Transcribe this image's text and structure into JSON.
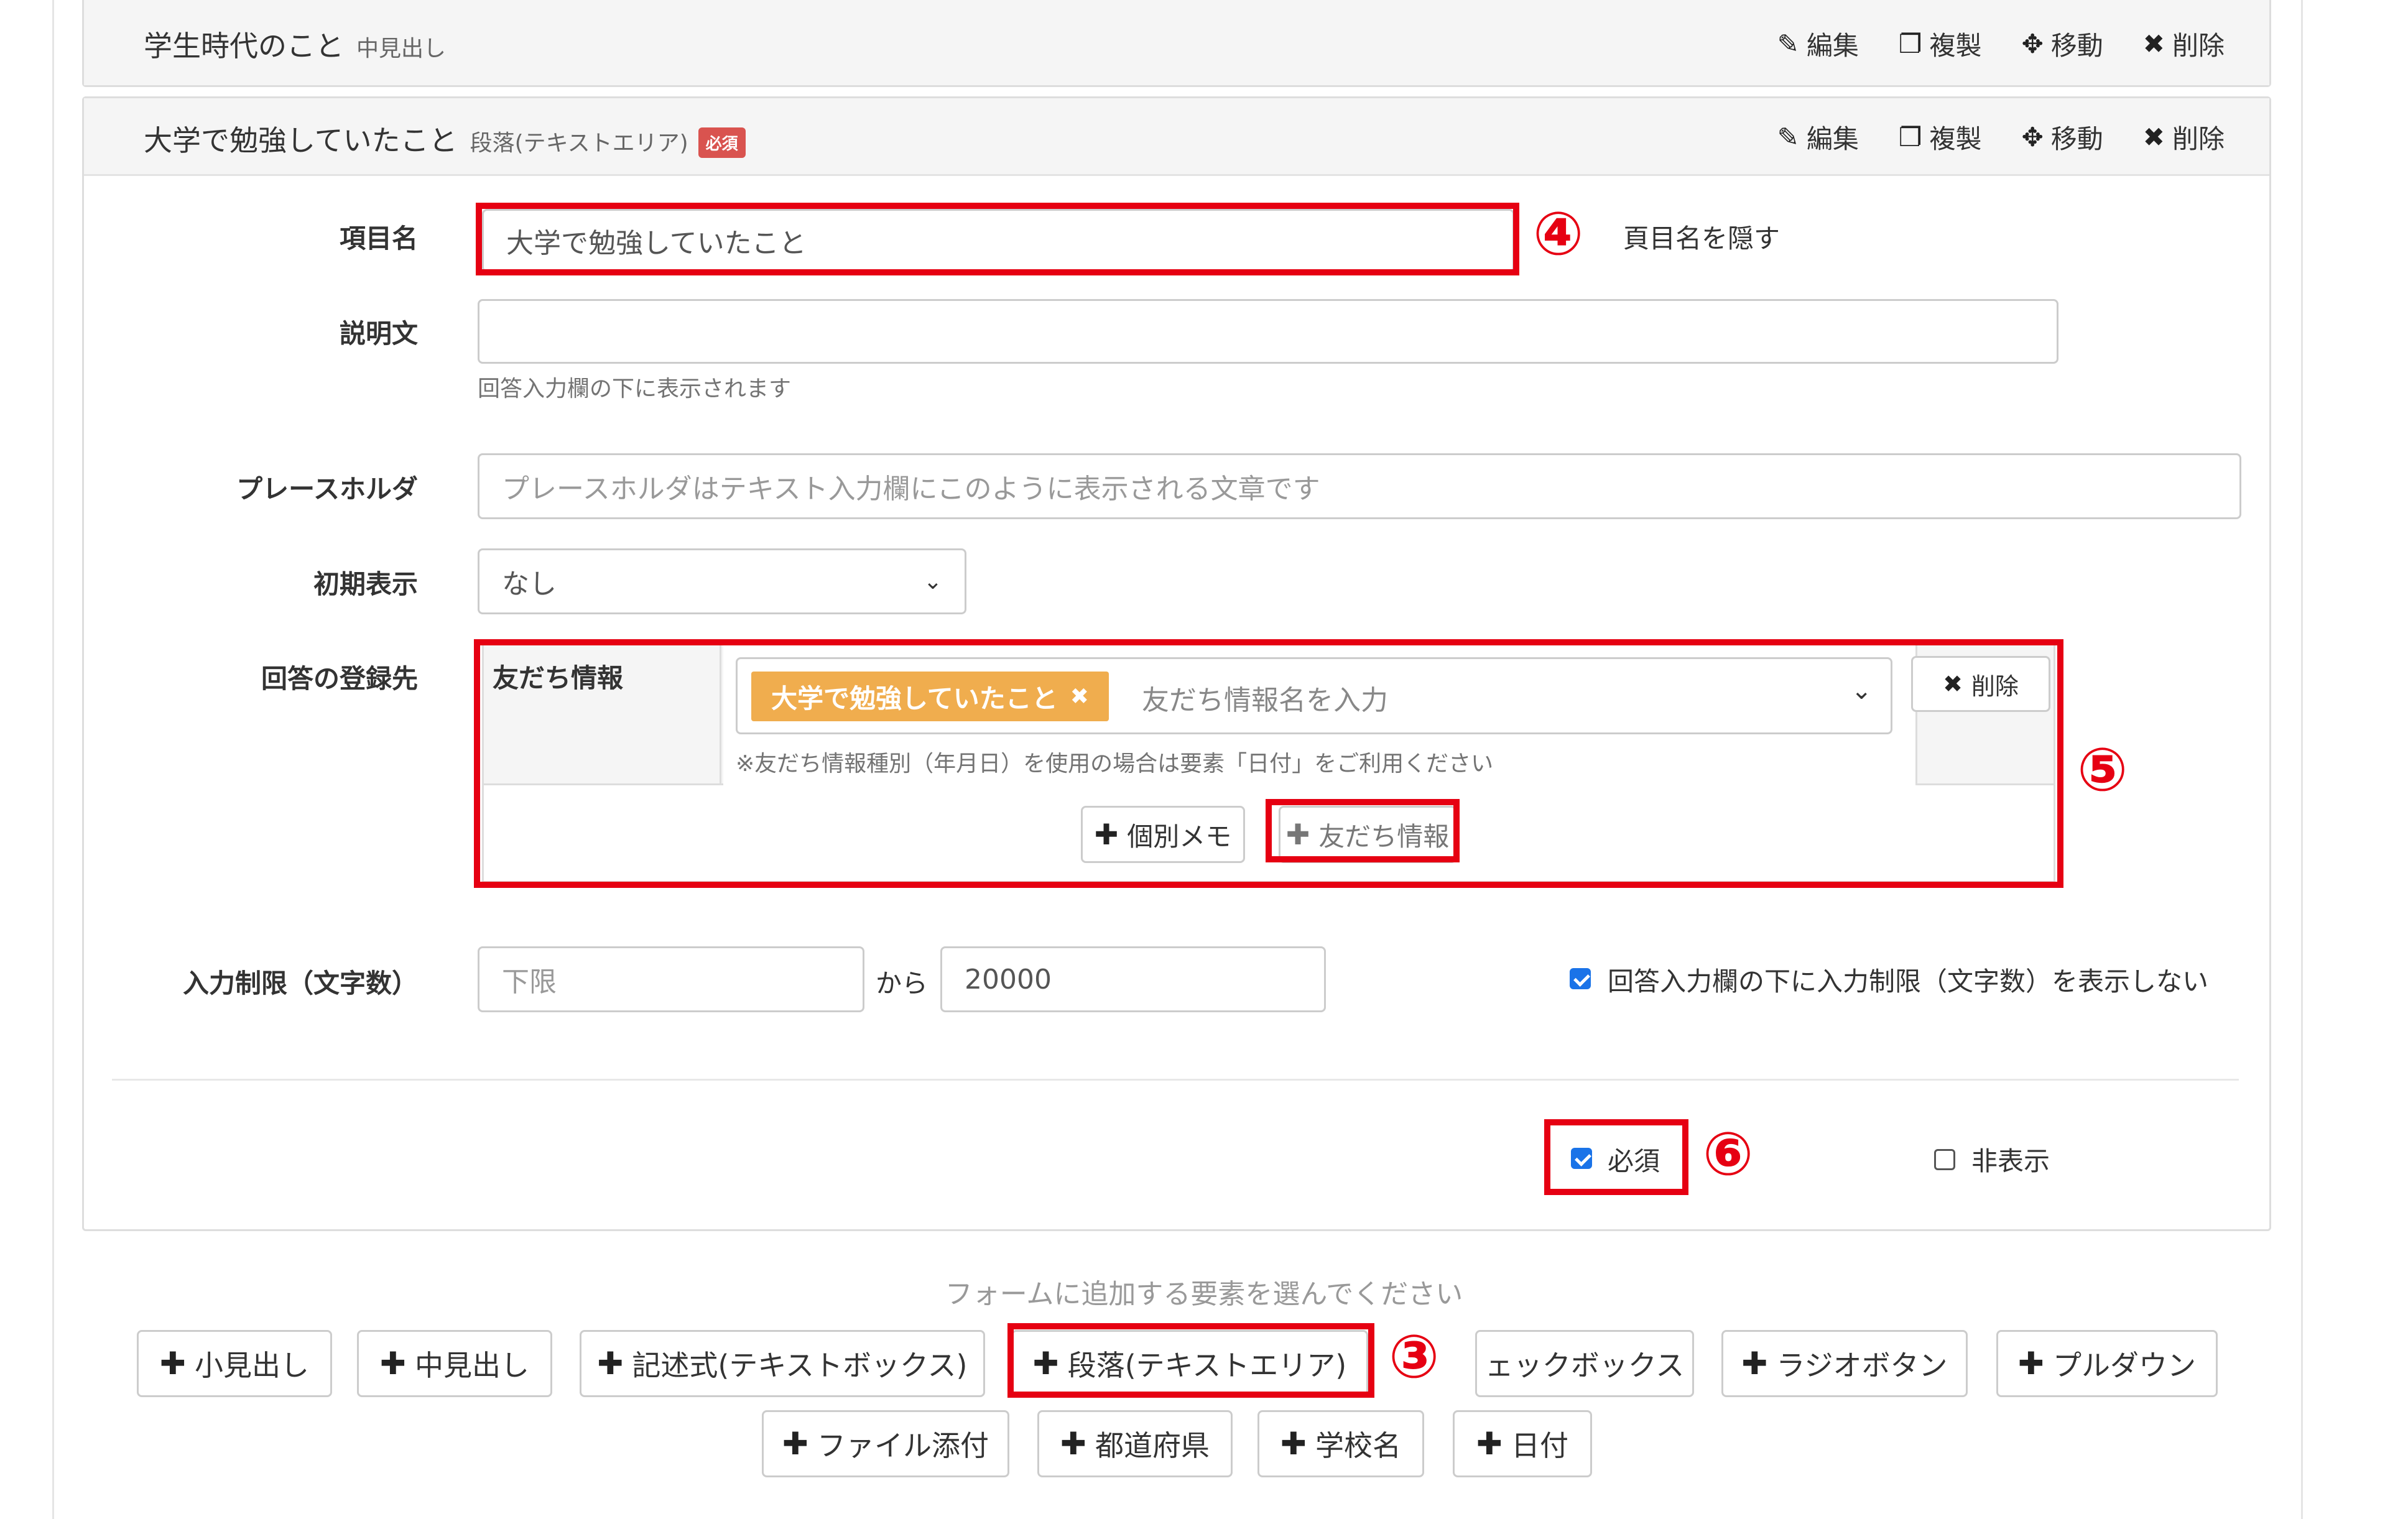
{
  "panel1": {
    "title": "学生時代のこと",
    "type": "中見出し",
    "actions": {
      "edit": "編集",
      "copy": "複製",
      "move": "移動",
      "delete": "削除"
    }
  },
  "panel2": {
    "title": "大学で勉強していたこと",
    "type": "段落(テキストエリア)",
    "required_badge": "必須",
    "actions": {
      "edit": "編集",
      "copy": "複製",
      "move": "移動",
      "delete": "削除"
    }
  },
  "form": {
    "item_name_label": "項目名",
    "item_name_value": "大学で勉強していたこと",
    "hide_name_label": "頁目名を隠す",
    "description_label": "説明文",
    "description_value": "",
    "description_help": "回答入力欄の下に表示されます",
    "placeholder_label": "プレースホルダ",
    "placeholder_placeholder": "プレースホルダはテキスト入力欄にこのように表示される文章です",
    "initial_label": "初期表示",
    "initial_value": "なし",
    "register_label": "回答の登録先",
    "friend_info_label": "友だち情報",
    "friend_tag": "大学で勉強していたこと",
    "friend_placeholder": "友だち情報名を入力",
    "friend_note": "※友だち情報種別（年月日）を使用の場合は要素「日付」をご利用ください",
    "delete_button": "削除",
    "memo_button": "個別メモ",
    "friend_button": "友だち情報",
    "limit_label": "入力制限（文字数）",
    "limit_min_placeholder": "下限",
    "limit_from": "から",
    "limit_max_value": "20000",
    "hide_limit_label": "回答入力欄の下に入力制限（文字数）を表示しない",
    "hide_limit_checked": true,
    "required_label": "必須",
    "required_checked": true,
    "hidden_label": "非表示",
    "hidden_checked": false
  },
  "annotations": {
    "n3": "③",
    "n4": "④",
    "n5": "⑤",
    "n6": "⑥"
  },
  "add_section": {
    "hint": "フォームに追加する要素を選んでください",
    "row1": [
      "小見出し",
      "中見出し",
      "記述式(テキストボックス)",
      "段落(テキストエリア)",
      "ェックボックス",
      "ラジオボタン",
      "プルダウン"
    ],
    "row2": [
      "ファイル添付",
      "都道府県",
      "学校名",
      "日付"
    ]
  },
  "colors": {
    "annotation_red": "#e60012",
    "tag_orange": "#f0ad4e",
    "badge_red": "#d9534f",
    "checkbox_blue": "#1a73e8"
  },
  "icons": {
    "edit": "pencil-icon",
    "copy": "copy-icon",
    "move": "move-icon",
    "delete": "close-icon",
    "add": "plus-icon",
    "dropdown": "chevron-down-icon"
  }
}
